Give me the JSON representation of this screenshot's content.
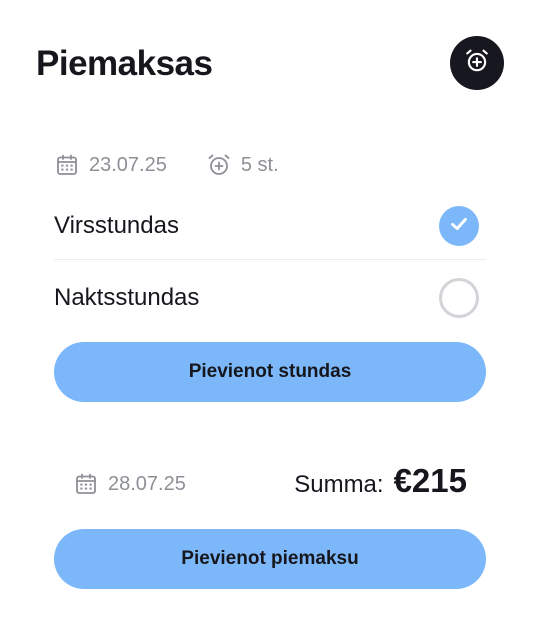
{
  "header": {
    "title": "Piemaksas",
    "add_alarm_icon": "alarm-plus-icon"
  },
  "entry": {
    "date": "23.07.25",
    "date_icon": "calendar-icon",
    "hours": "5 st.",
    "hours_icon": "alarm-plus-icon",
    "options": [
      {
        "label": "Virsstundas",
        "checked": true
      },
      {
        "label": "Naktsstundas",
        "checked": false
      }
    ],
    "add_hours_label": "Pievienot stundas"
  },
  "summary": {
    "date": "28.07.25",
    "date_icon": "calendar-icon",
    "sum_label": "Summa:",
    "sum_value": "€215",
    "add_payment_label": "Pievienot piemaksu"
  },
  "colors": {
    "accent": "#7cb8f9",
    "dark": "#16171f",
    "muted": "#8e9097"
  }
}
